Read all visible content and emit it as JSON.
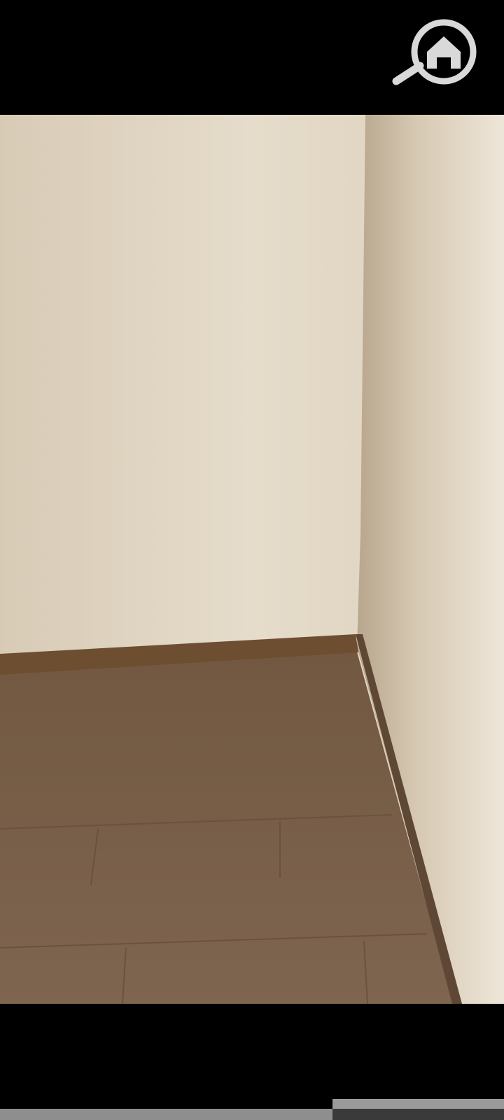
{
  "video": {
    "scene": "empty-room-corner",
    "colors": {
      "wall_light": "#E9DFCF",
      "wall_mid": "#D8CBB6",
      "wall_side": "#BFAE96",
      "skirting": "#6E4E30",
      "floor": "#7A6048",
      "floor_dark": "#5E4835"
    }
  },
  "watermark": {
    "icon": "house-magnifier-icon",
    "color": "#D9D9D9"
  },
  "playback": {
    "progress": 0.66
  }
}
